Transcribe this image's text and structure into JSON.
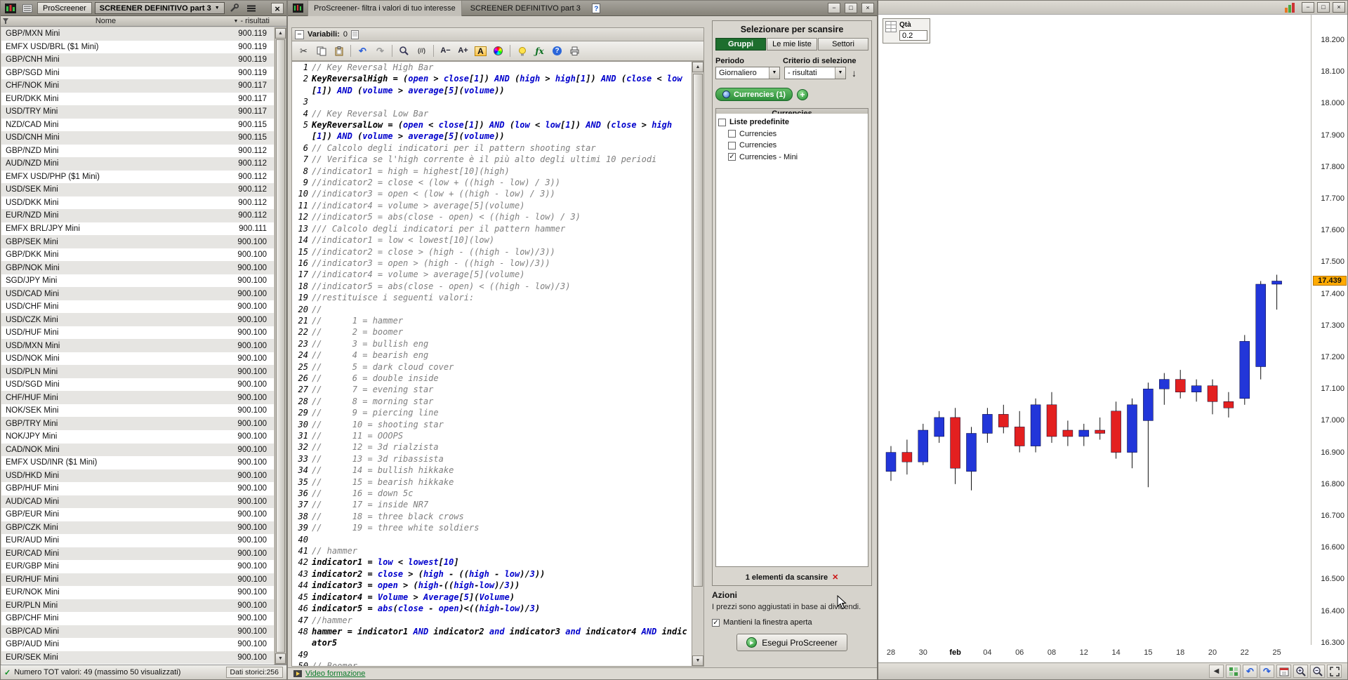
{
  "icons": {
    "minimize": "−",
    "maximize": "□",
    "close": "×",
    "caret_down": "▼",
    "check": "✓",
    "down_arrow": "↓",
    "cross_red": "✕",
    "collapse": "−",
    "scroll_up": "▲",
    "scroll_down": "▼"
  },
  "results_window": {
    "titlebar": {
      "app_button": "ProScreener",
      "screener_tab": "SCREENER DEFINITIVO part 3"
    },
    "header": {
      "name_col": "Nome",
      "sort_col": "- risultati"
    },
    "rows": [
      {
        "name": "GBP/MXN Mini",
        "value": "900.119"
      },
      {
        "name": "EMFX USD/BRL ($1 Mini)",
        "value": "900.119"
      },
      {
        "name": "GBP/CNH Mini",
        "value": "900.119"
      },
      {
        "name": "GBP/SGD Mini",
        "value": "900.119"
      },
      {
        "name": "CHF/NOK Mini",
        "value": "900.117"
      },
      {
        "name": "EUR/DKK Mini",
        "value": "900.117"
      },
      {
        "name": "USD/TRY Mini",
        "value": "900.117"
      },
      {
        "name": "NZD/CAD Mini",
        "value": "900.115"
      },
      {
        "name": "USD/CNH Mini",
        "value": "900.115"
      },
      {
        "name": "GBP/NZD Mini",
        "value": "900.112"
      },
      {
        "name": "AUD/NZD Mini",
        "value": "900.112"
      },
      {
        "name": "EMFX USD/PHP ($1 Mini)",
        "value": "900.112"
      },
      {
        "name": "USD/SEK Mini",
        "value": "900.112"
      },
      {
        "name": "USD/DKK Mini",
        "value": "900.112"
      },
      {
        "name": "EUR/NZD Mini",
        "value": "900.112"
      },
      {
        "name": "EMFX BRL/JPY Mini",
        "value": "900.111"
      },
      {
        "name": "GBP/SEK Mini",
        "value": "900.100"
      },
      {
        "name": "GBP/DKK Mini",
        "value": "900.100"
      },
      {
        "name": "GBP/NOK Mini",
        "value": "900.100"
      },
      {
        "name": "SGD/JPY Mini",
        "value": "900.100"
      },
      {
        "name": "USD/CAD Mini",
        "value": "900.100"
      },
      {
        "name": "USD/CHF Mini",
        "value": "900.100"
      },
      {
        "name": "USD/CZK Mini",
        "value": "900.100"
      },
      {
        "name": "USD/HUF Mini",
        "value": "900.100"
      },
      {
        "name": "USD/MXN Mini",
        "value": "900.100"
      },
      {
        "name": "USD/NOK Mini",
        "value": "900.100"
      },
      {
        "name": "USD/PLN Mini",
        "value": "900.100"
      },
      {
        "name": "USD/SGD Mini",
        "value": "900.100"
      },
      {
        "name": "CHF/HUF Mini",
        "value": "900.100"
      },
      {
        "name": "NOK/SEK Mini",
        "value": "900.100"
      },
      {
        "name": "GBP/TRY Mini",
        "value": "900.100"
      },
      {
        "name": "NOK/JPY Mini",
        "value": "900.100"
      },
      {
        "name": "CAD/NOK Mini",
        "value": "900.100"
      },
      {
        "name": "EMFX USD/INR ($1 Mini)",
        "value": "900.100"
      },
      {
        "name": "USD/HKD Mini",
        "value": "900.100"
      },
      {
        "name": "GBP/HUF Mini",
        "value": "900.100"
      },
      {
        "name": "AUD/CAD Mini",
        "value": "900.100"
      },
      {
        "name": "GBP/EUR Mini",
        "value": "900.100"
      },
      {
        "name": "GBP/CZK Mini",
        "value": "900.100"
      },
      {
        "name": "EUR/AUD Mini",
        "value": "900.100"
      },
      {
        "name": "EUR/CAD Mini",
        "value": "900.100"
      },
      {
        "name": "EUR/GBP Mini",
        "value": "900.100"
      },
      {
        "name": "EUR/HUF Mini",
        "value": "900.100"
      },
      {
        "name": "EUR/NOK Mini",
        "value": "900.100"
      },
      {
        "name": "EUR/PLN Mini",
        "value": "900.100"
      },
      {
        "name": "GBP/CHF Mini",
        "value": "900.100"
      },
      {
        "name": "GBP/CAD Mini",
        "value": "900.100"
      },
      {
        "name": "GBP/AUD Mini",
        "value": "900.100"
      },
      {
        "name": "EUR/SEK Mini",
        "value": "900.100"
      }
    ],
    "status": {
      "total_text": "Numero TOT valori: 49 (massimo 50 visualizzati)",
      "history_text": "Dati storici:256"
    }
  },
  "editor_window": {
    "titlebar": {
      "tab_main": "ProScreener- filtra i valori di tuo interesse",
      "tab_screener": "SCREENER DEFINITIVO part 3"
    },
    "variables_bar": {
      "label": "Variabili:",
      "count": "0"
    },
    "toolbar_icons": [
      "cut-icon",
      "copy-icon",
      "paste-icon",
      "undo-icon",
      "redo-icon",
      "search-icon",
      "comment-icon",
      "font-decrease-icon",
      "font-increase-icon",
      "highlight-icon",
      "color-wheel-icon",
      "suggestion-icon",
      "function-icon",
      "help-icon",
      "print-icon"
    ],
    "code_lines": [
      "// Key Reversal High Bar",
      "KeyReversalHigh = (open > close[1]) AND (high > high[1]) AND (close < low[1]) AND (volume > average[5](volume))",
      "",
      "// Key Reversal Low Bar",
      "KeyReversalLow = (open < close[1]) AND (low < low[1]) AND (close > high[1]) AND (volume > average[5](volume))",
      "// Calcolo degli indicatori per il pattern shooting star",
      "// Verifica se l'high corrente è il più alto degli ultimi 10 periodi",
      "//indicator1 = high = highest[10](high)",
      "//indicator2 = close < (low + ((high - low) / 3))",
      "//indicator3 = open < (low + ((high - low) / 3))",
      "//indicator4 = volume > average[5](volume)",
      "//indicator5 = abs(close - open) < ((high - low) / 3)",
      "/// Calcolo degli indicatori per il pattern hammer",
      "//indicator1 = low < lowest[10](low)",
      "//indicator2 = close > (high - ((high - low)/3))",
      "//indicator3 = open > (high - ((high - low)/3))",
      "//indicator4 = volume > average[5](volume)",
      "//indicator5 = abs(close - open) < ((high - low)/3)",
      "//restituisce i seguenti valori:",
      "//",
      "//      1 = hammer",
      "//      2 = boomer",
      "//      3 = bullish eng",
      "//      4 = bearish eng",
      "//      5 = dark cloud cover",
      "//      6 = double inside",
      "//      7 = evening star",
      "//      8 = morning star",
      "//      9 = piercing line",
      "//      10 = shooting star",
      "//      11 = OOOPS",
      "//      12 = 3d rialzista",
      "//      13 = 3d ribassista",
      "//      14 = bullish hikkake",
      "//      15 = bearish hikkake",
      "//      16 = down 5c",
      "//      17 = inside NR7",
      "//      18 = three black crows",
      "//      19 = three white soldiers",
      "",
      "// hammer",
      "indicator1 = low < lowest[10]",
      "indicator2 = close > (high - ((high - low)/3))",
      "indicator3 = open > (high-((high-low)/3))",
      "indicator4 = Volume > Average[5](Volume)",
      "indicator5 = abs(close - open)<((high-low)/3)",
      "//hammer",
      "hammer = indicator1 AND indicator2 and indicator3 and indicator4 AND indicator5",
      "",
      "// Boomer"
    ],
    "video_link": "Video formazione"
  },
  "scan_panel": {
    "title": "Selezionare per scansire",
    "tabs": [
      {
        "label": "Gruppi",
        "active": true
      },
      {
        "label": "Le mie liste",
        "active": false
      },
      {
        "label": "Settori",
        "active": false
      }
    ],
    "period_label": "Periodo",
    "period_value": "Giornaliero",
    "criteria_label": "Criterio di selezione",
    "criteria_value": "- risultati",
    "group_chip": "Currencies (1)",
    "list_title": "Currencies",
    "tree": [
      {
        "label": "Liste predefinite",
        "checked": false,
        "bold": true,
        "indent": 0
      },
      {
        "label": "Currencies",
        "checked": false,
        "bold": false,
        "indent": 1
      },
      {
        "label": "Currencies",
        "checked": false,
        "bold": false,
        "indent": 1
      },
      {
        "label": "Currencies - Mini",
        "checked": true,
        "bold": false,
        "indent": 1
      }
    ],
    "elements_text": "1 elementi da scansire",
    "actions_label": "Azioni",
    "adjust_note": "I prezzi sono aggiustati in base ai dividendi.",
    "keep_open": {
      "label": "Mantieni la finestra aperta",
      "checked": true
    },
    "run_button": "Esegui ProScreener"
  },
  "chart_window": {
    "qty": {
      "label": "Qtà",
      "value": "0.2"
    },
    "toolbar_icons": [
      "prev-page-icon",
      "layout-icon",
      "undo-icon",
      "redo-icon",
      "calendar-icon",
      "zoom-in-icon",
      "zoom-out-icon",
      "expand-icon"
    ],
    "chart_data": {
      "type": "candlestick",
      "period": "Giornaliero",
      "up_color": "#2236d9",
      "down_color": "#e32020",
      "wick_color": "#111111",
      "last_price": "17.439",
      "last_price_value": 17.439,
      "y_axis": {
        "max": 18.25,
        "min": 16.27,
        "ticks": [
          "18.200",
          "18.100",
          "18.000",
          "17.900",
          "17.800",
          "17.700",
          "17.600",
          "17.500",
          "17.400",
          "17.300",
          "17.200",
          "17.100",
          "17.000",
          "16.900",
          "16.800",
          "16.700",
          "16.600",
          "16.500",
          "16.400",
          "16.300"
        ]
      },
      "x_labels": [
        {
          "label": "28",
          "index": 0
        },
        {
          "label": "30",
          "index": 2
        },
        {
          "label": "feb",
          "index": 4
        },
        {
          "label": "04",
          "index": 6
        },
        {
          "label": "06",
          "index": 8
        },
        {
          "label": "08",
          "index": 10
        },
        {
          "label": "12",
          "index": 12
        },
        {
          "label": "14",
          "index": 14
        },
        {
          "label": "15",
          "index": 16
        },
        {
          "label": "18",
          "index": 18
        },
        {
          "label": "20",
          "index": 20
        },
        {
          "label": "22",
          "index": 22
        },
        {
          "label": "25",
          "index": 24
        }
      ],
      "candles": [
        {
          "o": 16.84,
          "h": 16.92,
          "l": 16.81,
          "c": 16.9
        },
        {
          "o": 16.9,
          "h": 16.94,
          "l": 16.83,
          "c": 16.87
        },
        {
          "o": 16.87,
          "h": 16.99,
          "l": 16.86,
          "c": 16.97
        },
        {
          "o": 16.95,
          "h": 17.03,
          "l": 16.93,
          "c": 17.01
        },
        {
          "o": 17.01,
          "h": 17.04,
          "l": 16.8,
          "c": 16.85
        },
        {
          "o": 16.84,
          "h": 16.98,
          "l": 16.78,
          "c": 16.96
        },
        {
          "o": 16.96,
          "h": 17.04,
          "l": 16.93,
          "c": 17.02
        },
        {
          "o": 17.02,
          "h": 17.05,
          "l": 16.96,
          "c": 16.98
        },
        {
          "o": 16.98,
          "h": 17.03,
          "l": 16.9,
          "c": 16.92
        },
        {
          "o": 16.92,
          "h": 17.07,
          "l": 16.9,
          "c": 17.05
        },
        {
          "o": 17.05,
          "h": 17.09,
          "l": 16.93,
          "c": 16.95
        },
        {
          "o": 16.97,
          "h": 17.0,
          "l": 16.92,
          "c": 16.95
        },
        {
          "o": 16.95,
          "h": 16.99,
          "l": 16.92,
          "c": 16.97
        },
        {
          "o": 16.97,
          "h": 17.01,
          "l": 16.94,
          "c": 16.96
        },
        {
          "o": 17.03,
          "h": 17.06,
          "l": 16.88,
          "c": 16.9
        },
        {
          "o": 16.9,
          "h": 17.07,
          "l": 16.85,
          "c": 17.05
        },
        {
          "o": 17.0,
          "h": 17.12,
          "l": 16.79,
          "c": 17.1
        },
        {
          "o": 17.1,
          "h": 17.15,
          "l": 17.05,
          "c": 17.13
        },
        {
          "o": 17.13,
          "h": 17.16,
          "l": 17.07,
          "c": 17.09
        },
        {
          "o": 17.09,
          "h": 17.13,
          "l": 17.06,
          "c": 17.11
        },
        {
          "o": 17.11,
          "h": 17.13,
          "l": 17.02,
          "c": 17.06
        },
        {
          "o": 17.06,
          "h": 17.09,
          "l": 17.01,
          "c": 17.04
        },
        {
          "o": 17.07,
          "h": 17.27,
          "l": 17.05,
          "c": 17.25
        },
        {
          "o": 17.17,
          "h": 17.44,
          "l": 17.13,
          "c": 17.43
        },
        {
          "o": 17.43,
          "h": 17.46,
          "l": 17.35,
          "c": 17.44
        }
      ]
    }
  }
}
